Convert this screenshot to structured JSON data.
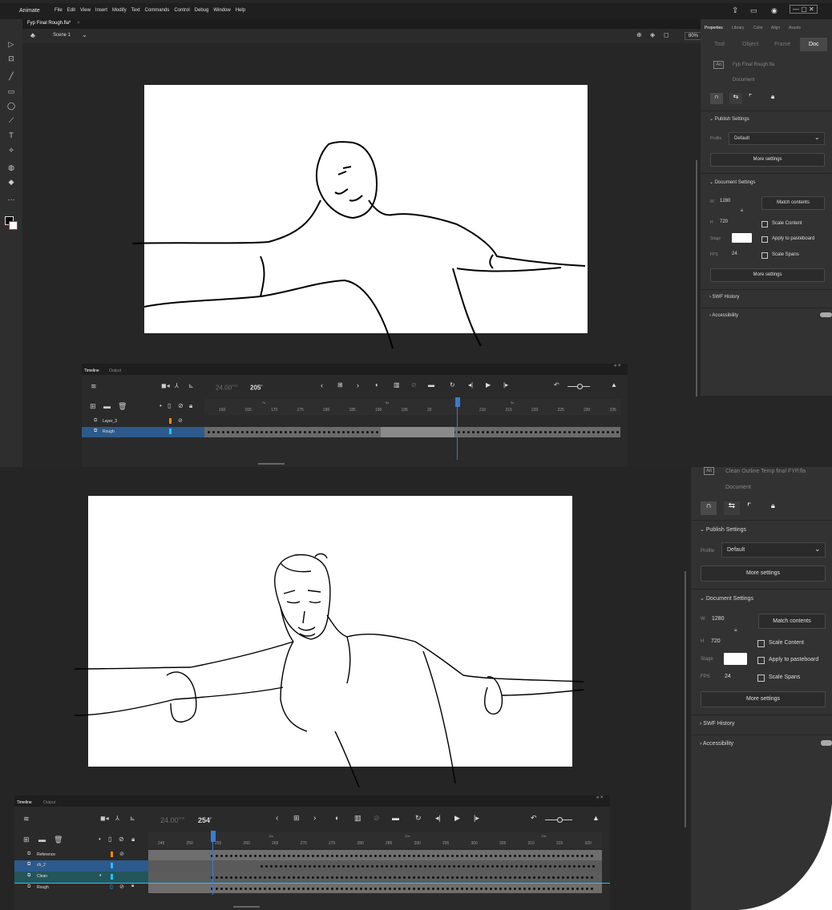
{
  "app": {
    "title": "Animate"
  },
  "menu": [
    "File",
    "Edit",
    "View",
    "Insert",
    "Modify",
    "Text",
    "Commands",
    "Control",
    "Debug",
    "Window",
    "Help"
  ],
  "top": {
    "doc_tab": "Fyp Final Rough.fla*",
    "scene": "Scene 1",
    "zoom": "80%",
    "props_tabs": [
      "Properties",
      "Library",
      "Color",
      "Align",
      "Assets"
    ],
    "sub_tabs": [
      "Tool",
      "Object",
      "Frame",
      "Doc"
    ],
    "file_name": "Fyp Final Rough.fla",
    "file_type": "Document",
    "publish_settings": "Publish Settings",
    "profile_label": "Profile",
    "profile_value": "Default",
    "more_settings": "More settings",
    "document_settings": "Document Settings",
    "w_label": "W",
    "w_value": "1280",
    "h_label": "H",
    "h_value": "720",
    "match_contents": "Match contents",
    "scale_content": "Scale Content",
    "stage_label": "Stage",
    "apply_pasteboard": "Apply to pasteboard",
    "fps_label": "FPS",
    "fps_value": "24",
    "scale_spans": "Scale Spans",
    "more_settings2": "More settings",
    "swf_history": "SWF History",
    "accessibility": "Accessibility",
    "timeline_tab": "Timeline",
    "output_tab": "Output",
    "fps_display": "24.00",
    "fps_unit": "FPS",
    "frame_display": "205",
    "frame_unit": "F",
    "ticks": [
      "160",
      "165",
      "170",
      "175",
      "180",
      "185",
      "190",
      "195",
      "20",
      "",
      "210",
      "215",
      "220",
      "225",
      "230",
      "235"
    ],
    "seconds": [
      "7s",
      "8s",
      "9s"
    ],
    "layers": [
      "Layer_3",
      "Rough"
    ]
  },
  "bottom": {
    "file_name": "Clean Outline Temp final FYP.fla",
    "file_type": "Document",
    "publish_settings": "Publish Settings",
    "profile_label": "Profile",
    "profile_value": "Default",
    "more_settings": "More settings",
    "document_settings": "Document Settings",
    "w_label": "W",
    "w_value": "1280",
    "h_label": "H",
    "h_value": "720",
    "match_contents": "Match contents",
    "scale_content": "Scale Content",
    "stage_label": "Stage",
    "apply_pasteboard": "Apply to pasteboard",
    "fps_label": "FPS",
    "fps_value": "24",
    "scale_spans": "Scale Spans",
    "more_settings2": "More settings",
    "swf_history": "SWF History",
    "accessibility": "Accessibility",
    "timeline_tab": "Timeline",
    "output_tab": "Output",
    "fps_display": "24.00",
    "fps_unit": "FPS",
    "frame_display": "254",
    "frame_unit": "F",
    "ticks": [
      "245",
      "250",
      "255",
      "260",
      "265",
      "270",
      "275",
      "280",
      "285",
      "290",
      "295",
      "300",
      "305",
      "310",
      "315",
      "320"
    ],
    "seconds": [
      "11s",
      "12s",
      "13s"
    ],
    "layers": [
      "Reference",
      "ch_2",
      "Clean",
      "Rough"
    ]
  },
  "colors": {
    "accent": "#1473e6",
    "layer_selected": "#2d5a8c",
    "playhead": "#3a7bd5",
    "stage": "#ffffff",
    "orange": "#ff8a00",
    "cyan": "#20c4ff"
  }
}
